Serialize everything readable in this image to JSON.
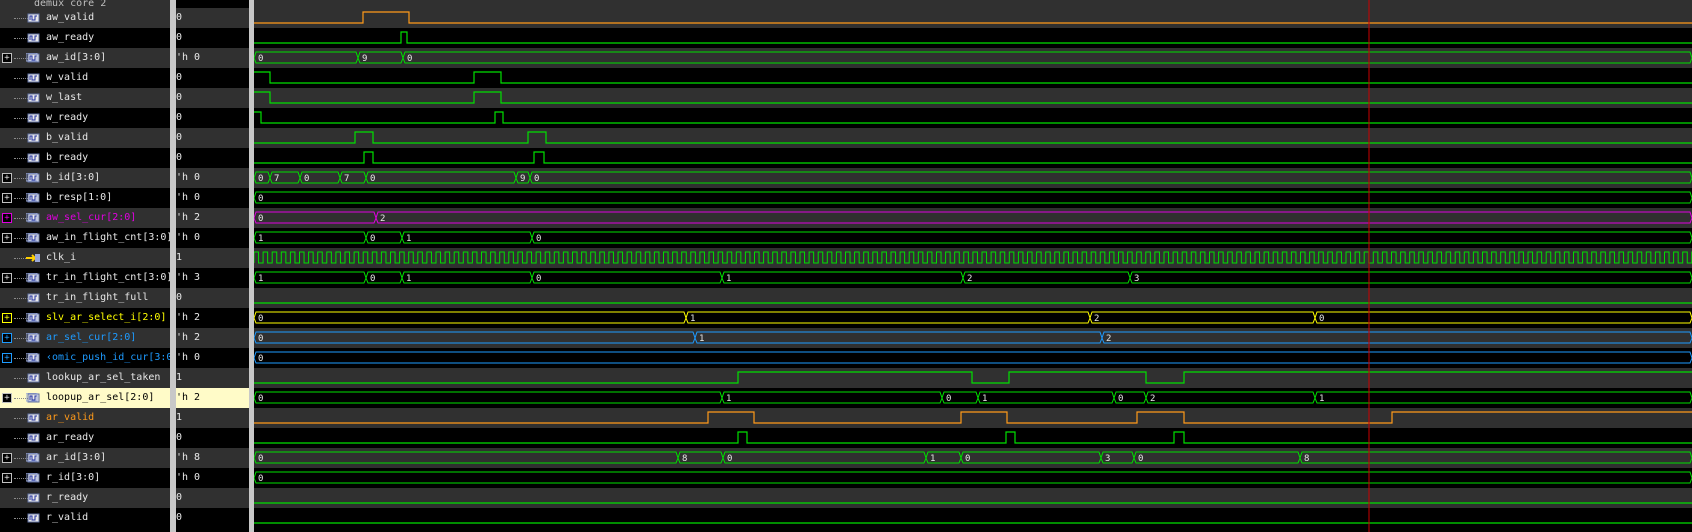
{
  "scope": {
    "label": "demux_core_2"
  },
  "colors": {
    "row_dark": "#303030",
    "row_black": "#000000",
    "selected_bg": "#fffbc8",
    "green": "#00e000",
    "orange": "#ff9a1a",
    "magenta": "#e000e0",
    "yellow": "#ffff00",
    "blue": "#1e9bff",
    "cursor": "#cc0000",
    "white": "#e8e8e8"
  },
  "signals": [
    {
      "name": "aw_valid",
      "value": "0",
      "bus": false,
      "color": "white",
      "wave": "orange"
    },
    {
      "name": "aw_ready",
      "value": "0",
      "bus": false,
      "color": "white",
      "wave": "green"
    },
    {
      "name": "aw_id[3:0]",
      "value": "'h 0",
      "bus": true,
      "color": "white",
      "wave": "green"
    },
    {
      "name": "w_valid",
      "value": "0",
      "bus": false,
      "color": "white",
      "wave": "green"
    },
    {
      "name": "w_last",
      "value": "0",
      "bus": false,
      "color": "white",
      "wave": "green"
    },
    {
      "name": "w_ready",
      "value": "0",
      "bus": false,
      "color": "white",
      "wave": "green"
    },
    {
      "name": "b_valid",
      "value": "0",
      "bus": false,
      "color": "white",
      "wave": "green"
    },
    {
      "name": "b_ready",
      "value": "0",
      "bus": false,
      "color": "white",
      "wave": "green"
    },
    {
      "name": "b_id[3:0]",
      "value": "'h 0",
      "bus": true,
      "color": "white",
      "wave": "green"
    },
    {
      "name": "b_resp[1:0]",
      "value": "'h 0",
      "bus": true,
      "color": "white",
      "wave": "green"
    },
    {
      "name": "aw_sel_cur[2:0]",
      "value": "'h 2",
      "bus": true,
      "color": "magenta",
      "wave": "magenta"
    },
    {
      "name": "aw_in_flight_cnt[3:0]",
      "value": "'h 0",
      "bus": true,
      "color": "white",
      "wave": "green"
    },
    {
      "name": "clk_i",
      "value": "1",
      "bus": false,
      "color": "white",
      "wave": "green",
      "clock": true
    },
    {
      "name": "tr_in_flight_cnt[3:0]",
      "value": "'h 3",
      "bus": true,
      "color": "white",
      "wave": "green"
    },
    {
      "name": "tr_in_flight_full",
      "value": "0",
      "bus": false,
      "color": "white",
      "wave": "green"
    },
    {
      "name": "slv_ar_select_i[2:0]",
      "value": "'h 2",
      "bus": true,
      "color": "yellow",
      "wave": "yellow"
    },
    {
      "name": "ar_sel_cur[2:0]",
      "value": "'h 2",
      "bus": true,
      "color": "blue",
      "wave": "blue"
    },
    {
      "name": "‹omic_push_id_cur[3:0]",
      "value": "'h 0",
      "bus": true,
      "color": "blue",
      "wave": "blue"
    },
    {
      "name": "lookup_ar_sel_taken",
      "value": "1",
      "bus": false,
      "color": "white",
      "wave": "green"
    },
    {
      "name": "loopup_ar_sel[2:0]",
      "value": "'h 2",
      "bus": true,
      "color": "white",
      "wave": "green",
      "selected": true
    },
    {
      "name": "ar_valid",
      "value": "1",
      "bus": false,
      "color": "orange",
      "wave": "orange"
    },
    {
      "name": "ar_ready",
      "value": "0",
      "bus": false,
      "color": "white",
      "wave": "green"
    },
    {
      "name": "ar_id[3:0]",
      "value": "'h 8",
      "bus": true,
      "color": "white",
      "wave": "green"
    },
    {
      "name": "r_id[3:0]",
      "value": "'h 0",
      "bus": true,
      "color": "white",
      "wave": "green"
    },
    {
      "name": "r_ready",
      "value": "0",
      "bus": false,
      "color": "white",
      "wave": "green"
    },
    {
      "name": "r_valid",
      "value": "0",
      "bus": false,
      "color": "white",
      "wave": "green"
    }
  ]
}
